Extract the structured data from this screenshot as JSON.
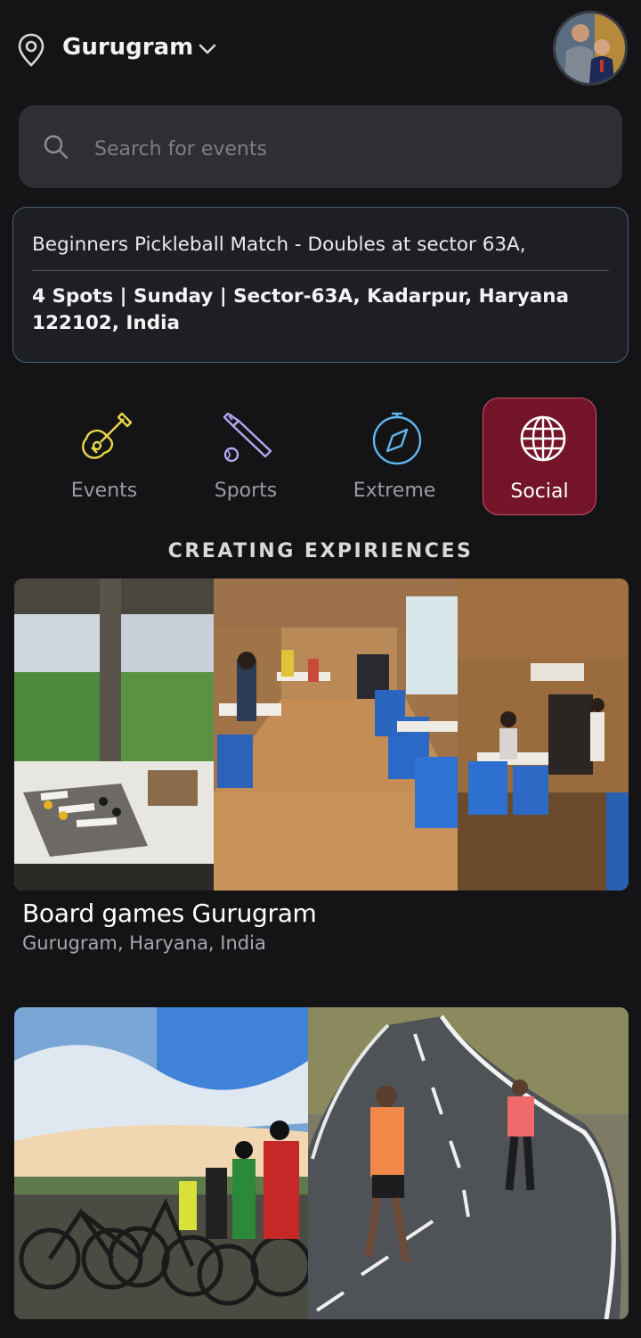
{
  "header": {
    "location": "Gurugram",
    "location_icon": "map-pin-icon",
    "chevron_icon": "chevron-down-icon"
  },
  "search": {
    "placeholder": "Search for events",
    "icon": "search-icon"
  },
  "info_card": {
    "title": "Beginners Pickleball Match - Doubles at sector 63A,",
    "details": "4 Spots | Sunday | Sector-63A, Kadarpur, Haryana 122102, India"
  },
  "categories": [
    {
      "label": "Events",
      "icon": "guitar-icon",
      "active": false
    },
    {
      "label": "Sports",
      "icon": "cricket-bat-icon",
      "active": false
    },
    {
      "label": "Extreme",
      "icon": "compass-icon",
      "active": false
    },
    {
      "label": "Social",
      "icon": "globe-icon",
      "active": true
    }
  ],
  "section_heading": "CREATING EXPIRIENCES",
  "events": [
    {
      "title": "Board games Gurugram",
      "location": "Gurugram, Haryana, India"
    },
    {
      "title": "",
      "location": ""
    }
  ],
  "colors": {
    "background": "#141316",
    "active_category": "#741428",
    "card_border": "#4a6178",
    "search_bg": "#2f2f33"
  }
}
